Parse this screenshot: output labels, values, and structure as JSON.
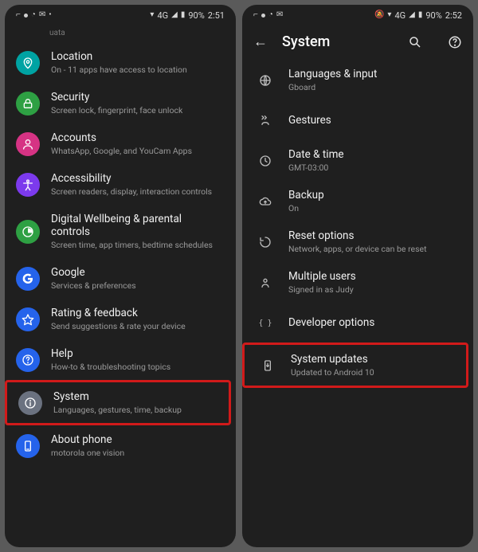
{
  "left": {
    "statusbar": {
      "net": "4G",
      "battery": "90%",
      "time": "2:51"
    },
    "partial_top": "uata",
    "items": [
      {
        "label": "Location",
        "sub": "On - 11 apps have access to location",
        "icon": "location-icon",
        "bg": "#00a3a3"
      },
      {
        "label": "Security",
        "sub": "Screen lock, fingerprint, face unlock",
        "icon": "lock-icon",
        "bg": "#2ea043"
      },
      {
        "label": "Accounts",
        "sub": "WhatsApp, Google, and YouCam Apps",
        "icon": "account-icon",
        "bg": "#d63384"
      },
      {
        "label": "Accessibility",
        "sub": "Screen readers, display, interaction controls",
        "icon": "accessibility-icon",
        "bg": "#7c3aed"
      },
      {
        "label": "Digital Wellbeing & parental controls",
        "sub": "Screen time, app timers, bedtime schedules",
        "icon": "wellbeing-icon",
        "bg": "#2ea043"
      },
      {
        "label": "Google",
        "sub": "Services & preferences",
        "icon": "google-icon",
        "bg": "#2563eb"
      },
      {
        "label": "Rating & feedback",
        "sub": "Send suggestions & rate your device",
        "icon": "star-icon",
        "bg": "#2563eb"
      },
      {
        "label": "Help",
        "sub": "How-to & troubleshooting topics",
        "icon": "help-icon",
        "bg": "#2563eb"
      },
      {
        "label": "System",
        "sub": "Languages, gestures, time, backup",
        "icon": "info-icon",
        "bg": "#6b7280",
        "highlight": true
      },
      {
        "label": "About phone",
        "sub": "motorola one vision",
        "icon": "phone-icon",
        "bg": "#2563eb"
      }
    ]
  },
  "right": {
    "statusbar": {
      "net": "4G",
      "battery": "90%",
      "time": "2:52"
    },
    "header": {
      "title": "System"
    },
    "items": [
      {
        "label": "Languages & input",
        "sub": "Gboard",
        "icon": "globe-icon"
      },
      {
        "label": "Gestures",
        "sub": "",
        "icon": "gestures-icon"
      },
      {
        "label": "Date & time",
        "sub": "GMT-03:00",
        "icon": "clock-icon"
      },
      {
        "label": "Backup",
        "sub": "On",
        "icon": "cloud-up-icon"
      },
      {
        "label": "Reset options",
        "sub": "Network, apps, or device can be reset",
        "icon": "reset-icon"
      },
      {
        "label": "Multiple users",
        "sub": "Signed in as Judy",
        "icon": "users-icon"
      },
      {
        "label": "Developer options",
        "sub": "",
        "icon": "braces-icon"
      },
      {
        "label": "System updates",
        "sub": "Updated to Android 10",
        "icon": "update-phone-icon",
        "highlight": true
      }
    ]
  }
}
